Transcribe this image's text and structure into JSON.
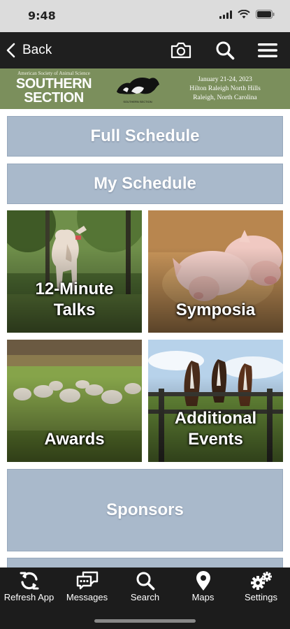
{
  "status_bar": {
    "time": "9:48"
  },
  "nav": {
    "back_label": "Back",
    "camera_icon": "camera-icon",
    "search_icon": "search-icon",
    "menu_icon": "hamburger-menu-icon"
  },
  "banner": {
    "org_line": "American Society of Animal Science",
    "title_line1": "SOUTHERN",
    "title_line2": "SECTION",
    "logo_caption": "SOUTHERN SECTION",
    "event_dates": "January 21-24, 2023",
    "event_venue": "Hilton Raleigh North Hills",
    "event_city": "Raleigh, North Carolina",
    "background_color": "#7b8f5c"
  },
  "tiles": {
    "full_schedule": "Full Schedule",
    "my_schedule": "My Schedule",
    "talks": "12-Minute\nTalks",
    "symposia": "Symposia",
    "awards": "Awards",
    "events": "Additional\nEvents",
    "sponsors": "Sponsors",
    "tile_color": "#a9b9cb"
  },
  "tab_bar": {
    "items": [
      {
        "label": "Refresh App",
        "icon": "refresh-icon"
      },
      {
        "label": "Messages",
        "icon": "messages-icon"
      },
      {
        "label": "Search",
        "icon": "search-icon"
      },
      {
        "label": "Maps",
        "icon": "map-pin-icon"
      },
      {
        "label": "Settings",
        "icon": "gears-icon"
      }
    ]
  }
}
